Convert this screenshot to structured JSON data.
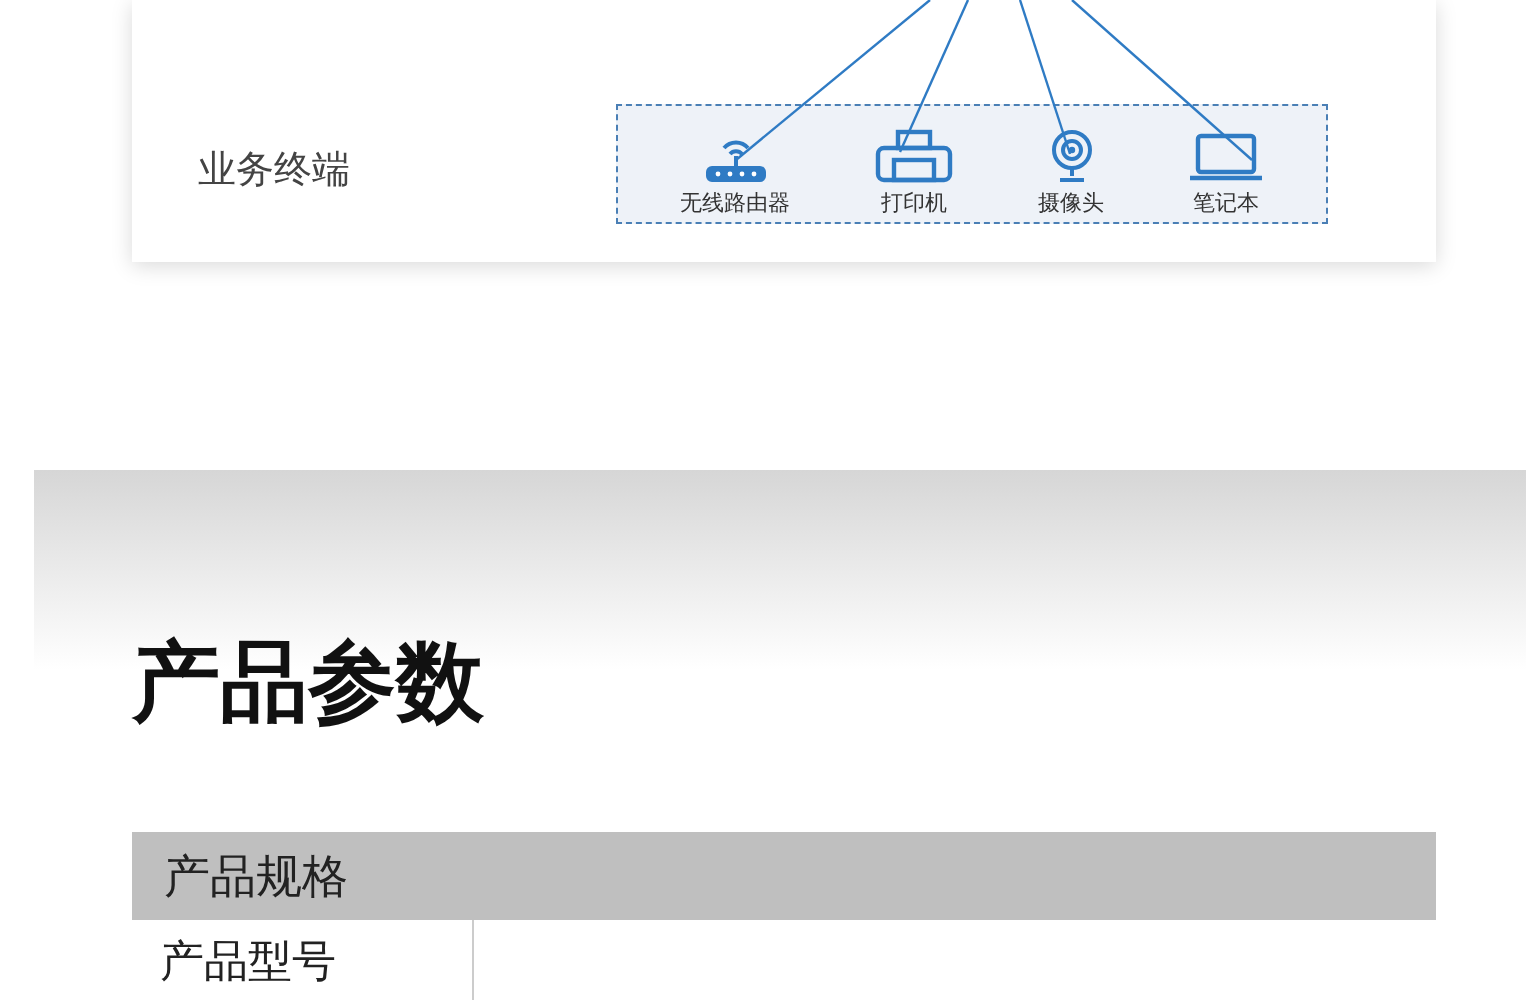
{
  "topology": {
    "tier_label": "业务终端",
    "devices": [
      {
        "kind": "router",
        "label": "无线路由器"
      },
      {
        "kind": "printer",
        "label": "打印机"
      },
      {
        "kind": "camera",
        "label": "摄像头"
      },
      {
        "kind": "laptop",
        "label": "笔记本"
      }
    ]
  },
  "specs": {
    "title": "产品参数",
    "table_header": "产品规格",
    "rows": [
      {
        "label": "产品型号"
      }
    ]
  }
}
